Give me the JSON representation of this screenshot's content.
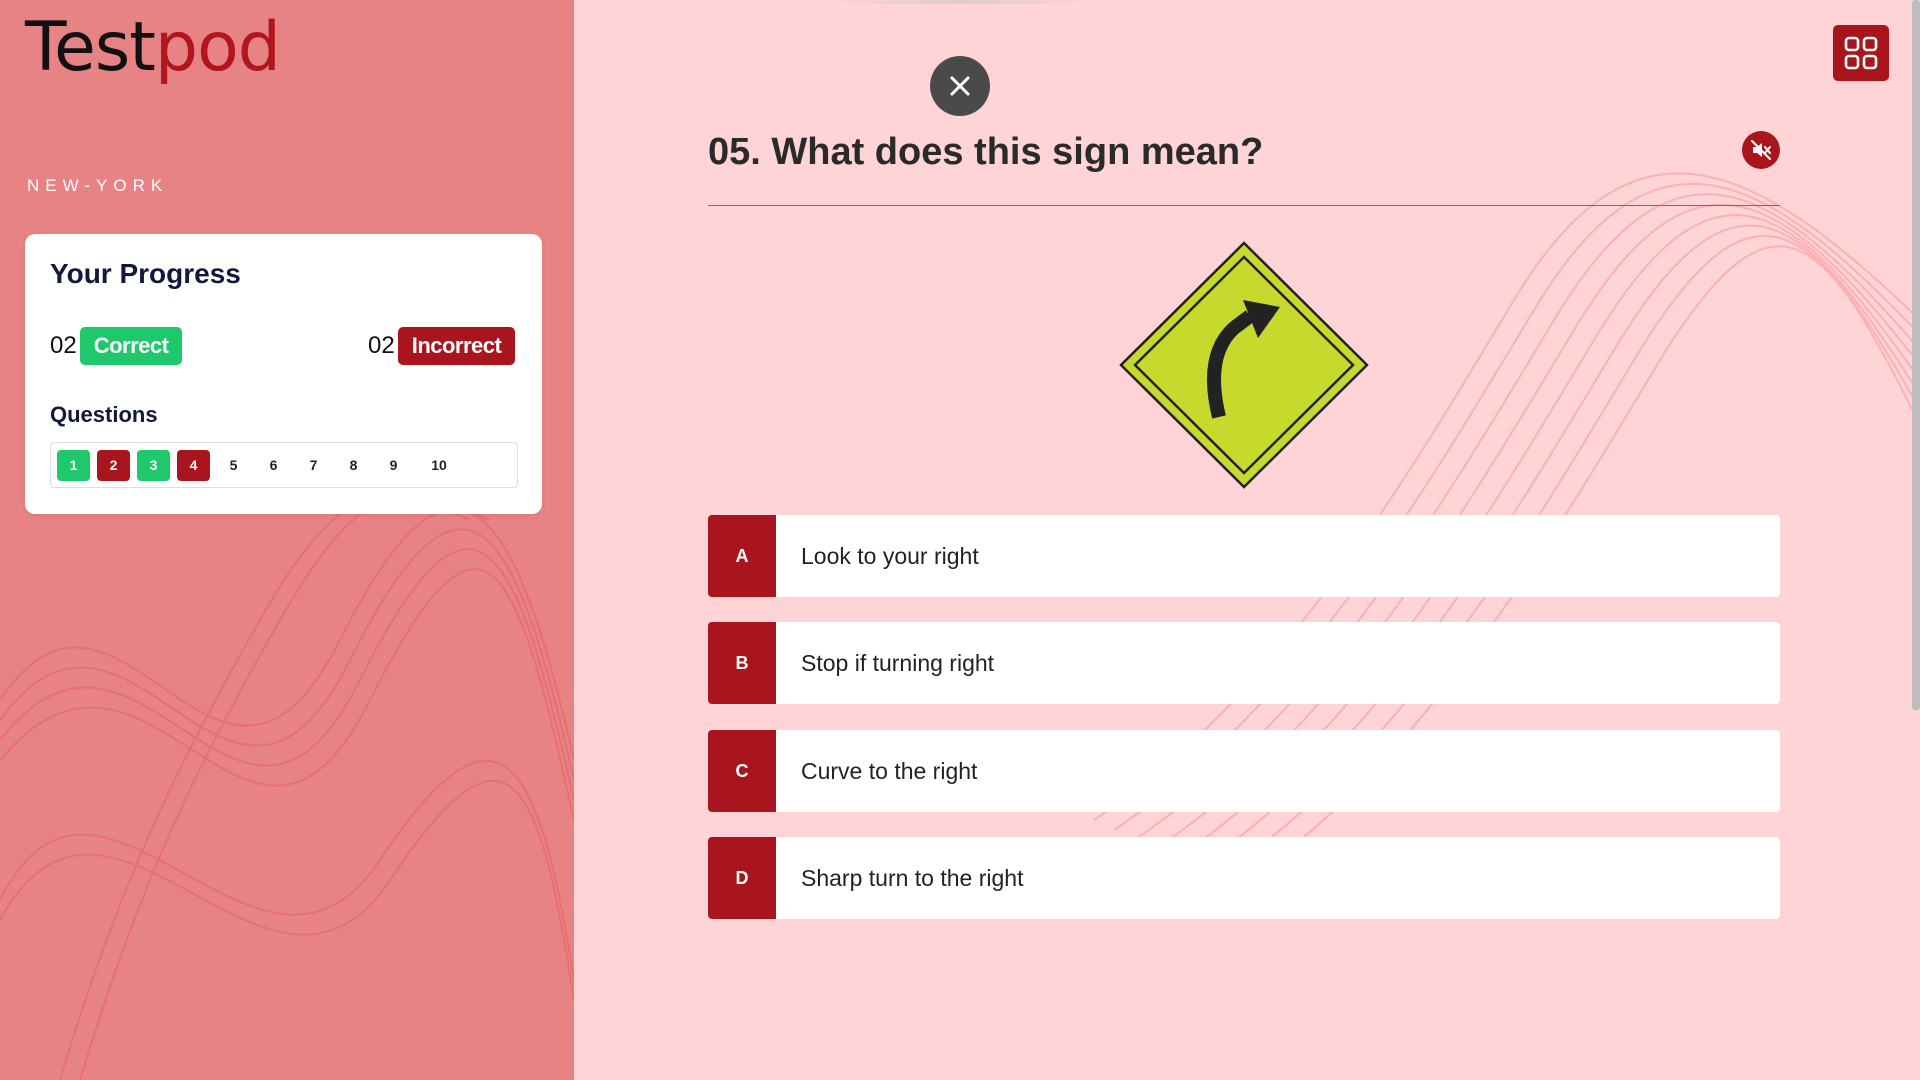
{
  "brand": {
    "part1": "Test",
    "part2": "pod"
  },
  "region": "NEW-YORK",
  "progress": {
    "title": "Your Progress",
    "correct_count": "02",
    "correct_label": "Correct",
    "incorrect_count": "02",
    "incorrect_label": "Incorrect",
    "questions_label": "Questions",
    "questions": [
      {
        "n": "1",
        "status": "correct"
      },
      {
        "n": "2",
        "status": "incorrect"
      },
      {
        "n": "3",
        "status": "correct"
      },
      {
        "n": "4",
        "status": "incorrect"
      },
      {
        "n": "5",
        "status": "unanswered"
      },
      {
        "n": "6",
        "status": "unanswered"
      },
      {
        "n": "7",
        "status": "unanswered"
      },
      {
        "n": "8",
        "status": "unanswered"
      },
      {
        "n": "9",
        "status": "unanswered"
      },
      {
        "n": "10",
        "status": "unanswered"
      }
    ]
  },
  "question": {
    "title": "05. What does this sign mean?",
    "options": [
      {
        "letter": "A",
        "text": "Look to your right"
      },
      {
        "letter": "B",
        "text": "Stop if turning right"
      },
      {
        "letter": "C",
        "text": "Curve to the right"
      },
      {
        "letter": "D",
        "text": "Sharp turn to the right"
      }
    ]
  },
  "icons": {
    "close": "close-icon",
    "menu": "grid-menu-icon",
    "mute": "speaker-muted-icon",
    "sign": "curve-right-sign"
  },
  "colors": {
    "accent": "#a8151c",
    "correct": "#1fc86a",
    "sidebar": "#e88385",
    "background": "#ffd4d6",
    "sign_yellow": "#c6d92c"
  }
}
